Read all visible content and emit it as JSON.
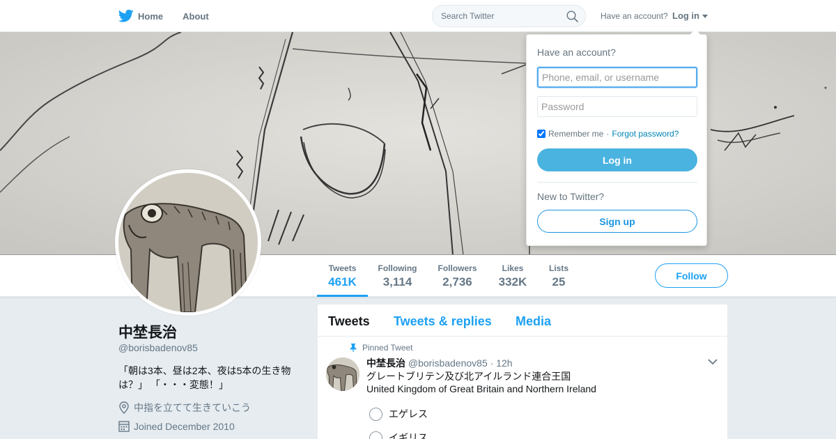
{
  "nav": {
    "home_label": "Home",
    "about_label": "About",
    "search_placeholder": "Search Twitter",
    "have_account": "Have an account?",
    "login_label": "Log in"
  },
  "colors": {
    "accent": "#1da1f2",
    "login_button": "#4ab3e0",
    "background": "#e6ecf0"
  },
  "stats": [
    {
      "label": "Tweets",
      "value": "461K"
    },
    {
      "label": "Following",
      "value": "3,114"
    },
    {
      "label": "Followers",
      "value": "2,736"
    },
    {
      "label": "Likes",
      "value": "332K"
    },
    {
      "label": "Lists",
      "value": "25"
    }
  ],
  "follow_label": "Follow",
  "profile": {
    "name": "中埜長治",
    "handle": "@borisbadenov85",
    "bio": "「朝は3本、昼は2本、夜は5本の生き物は？」 「・・・変態！」",
    "location": "中指を立てて生きていこう",
    "joined": "Joined December 2010"
  },
  "timeline": {
    "tabs": [
      "Tweets",
      "Tweets & replies",
      "Media"
    ],
    "active_tab": "Tweets",
    "pinned_label": "Pinned Tweet",
    "tweet": {
      "name": "中埜長治",
      "handle": "@borisbadenov85",
      "time": "· 12h",
      "line1": "グレートブリテン及び北アイルランド連合王国",
      "line2": "United Kingdom of Great Britain and Northern Ireland",
      "poll_options": [
        "エゲレス",
        "イギリス"
      ]
    }
  },
  "login_dropdown": {
    "title": "Have an account?",
    "username_placeholder": "Phone, email, or username",
    "password_placeholder": "Password",
    "remember_label": "Remember me",
    "separator": "·",
    "forgot_label": "Forgot password?",
    "login_button": "Log in",
    "new_label": "New to Twitter?",
    "signup_button": "Sign up"
  }
}
